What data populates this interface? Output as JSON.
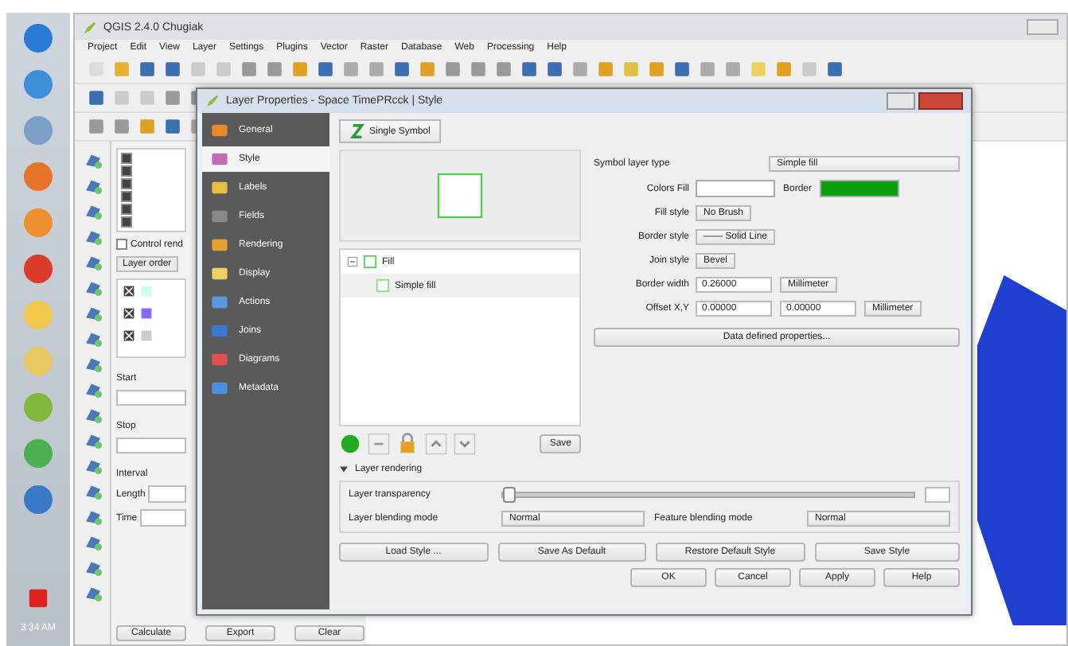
{
  "taskbar": {
    "clock": "3:34 AM"
  },
  "window": {
    "title": "QGIS 2.4.0 Chugiak"
  },
  "menu": [
    "Project",
    "Edit",
    "View",
    "Layer",
    "Settings",
    "Plugins",
    "Vector",
    "Raster",
    "Database",
    "Web",
    "Processing",
    "Help"
  ],
  "layers_panel": {
    "layers": [
      {
        "checked": true
      },
      {
        "checked": true
      },
      {
        "checked": true
      },
      {
        "checked": true
      },
      {
        "checked": true
      },
      {
        "checked": true
      }
    ],
    "control_rendering_order": {
      "label": "Control rend",
      "checked": false
    },
    "layer_order": "Layer order"
  },
  "measure": {
    "start": "Start",
    "stop": "Stop",
    "interval": "Interval",
    "length": "Length",
    "time": "Time",
    "buttons": [
      "Calculate",
      "Export",
      "Clear"
    ]
  },
  "dialog": {
    "title": "Layer Properties - Space TimePRcck | Style",
    "sections": [
      {
        "label": "General",
        "selected": false
      },
      {
        "label": "Style",
        "selected": true
      },
      {
        "label": "Labels",
        "selected": false
      },
      {
        "label": "Fields",
        "selected": false
      },
      {
        "label": "Rendering",
        "selected": false
      },
      {
        "label": "Display",
        "selected": false
      },
      {
        "label": "Actions",
        "selected": false
      },
      {
        "label": "Joins",
        "selected": false
      },
      {
        "label": "Diagrams",
        "selected": false
      },
      {
        "label": "Metadata",
        "selected": false
      }
    ],
    "renderer": "Single Symbol",
    "symbol_tree": [
      {
        "label": "Fill",
        "expanded": true,
        "children": [
          {
            "label": "Simple fill"
          }
        ]
      }
    ],
    "save": "Save",
    "symbol_layer_type": {
      "label": "Symbol layer type",
      "value": "Simple fill"
    },
    "colors": {
      "label": "Colors Fill",
      "border_label": "Border"
    },
    "properties": [
      {
        "kind": "combo",
        "label": "Fill style",
        "value": "No Brush"
      },
      {
        "kind": "combo",
        "label": "Border style",
        "value": "—— Solid Line"
      },
      {
        "kind": "combo",
        "label": "Join style",
        "value": "Bevel"
      },
      {
        "kind": "spin_unit",
        "label": "Border width",
        "value": "0.26000",
        "unit": "Millimeter"
      },
      {
        "kind": "offset",
        "label": "Offset X,Y",
        "value": "0.00000",
        "value2": "0.00000",
        "unit": "Millimeter"
      }
    ],
    "data_defined": "Data defined properties...",
    "layer_rendering": {
      "title": "Layer rendering",
      "expanded": true,
      "transparency_label": "Layer transparency",
      "level": 0,
      "layer_blending_label": "Layer blending mode",
      "layer_blending": "Normal",
      "feature_blending_label": "Feature blending mode",
      "feature_blending": "Normal"
    },
    "style_buttons": [
      "Load Style ...",
      "Save As Default",
      "Restore Default Style"
    ],
    "save_style": "Save Style",
    "buttons": [
      "OK",
      "Cancel",
      "Apply",
      "Help"
    ]
  }
}
